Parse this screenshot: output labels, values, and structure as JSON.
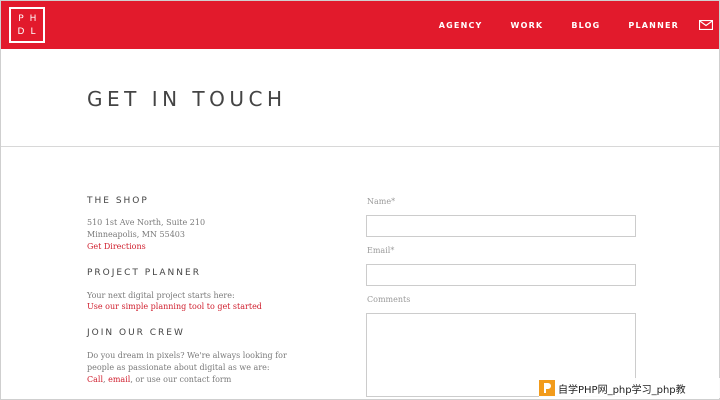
{
  "header": {
    "logo_letters": [
      "P",
      "H",
      "D",
      "L"
    ],
    "nav": [
      {
        "label": "AGENCY"
      },
      {
        "label": "WORK"
      },
      {
        "label": "BLOG"
      },
      {
        "label": "PLANNER"
      }
    ],
    "mail_icon": "mail-icon",
    "brand_color": "#e21a2c"
  },
  "page": {
    "title": "GET IN TOUCH"
  },
  "shop": {
    "heading": "THE SHOP",
    "address_line1": "510 1st Ave North, Suite 210",
    "address_line2": "Minneapolis, MN 55403",
    "directions_link": "Get Directions"
  },
  "planner": {
    "heading": "PROJECT PLANNER",
    "text": "Your next digital project starts here:",
    "link": "Use our simple planning tool to get started"
  },
  "crew": {
    "heading": "JOIN OUR CREW",
    "text_line1": "Do you dream in pixels? We're always looking for",
    "text_line2": "people as passionate about digital as we are:",
    "call_link": "Call",
    "sep": ", ",
    "email_link": "email",
    "tail": ", or use our contact form"
  },
  "form": {
    "name_label": "Name*",
    "name_value": "",
    "email_label": "Email*",
    "email_value": "",
    "comments_label": "Comments",
    "comments_value": ""
  },
  "watermark": {
    "text": "自学PHP网_php学习_php教"
  }
}
